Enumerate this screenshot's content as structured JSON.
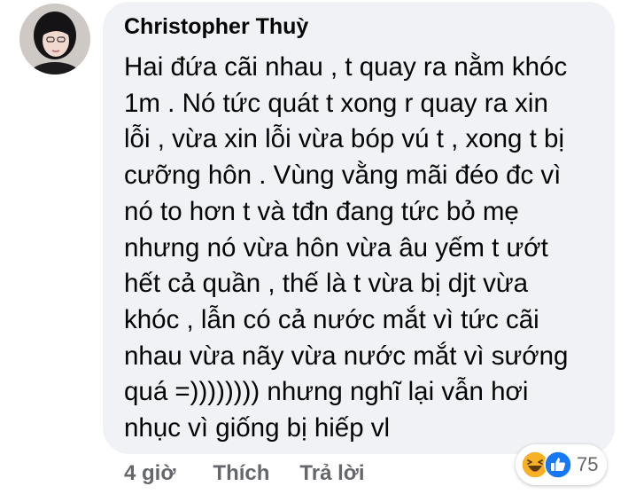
{
  "comment": {
    "author": "Christopher Thuỳ",
    "lines": [
      "Hai đứa cãi nhau , t quay ra nằm khóc",
      "1m . Nó tức quát t xong r quay ra xin",
      "lỗi , vừa xin lỗi vừa bóp vú t , xong t bị",
      "cưỡng hôn . Vùng vằng mãi đéo đc vì",
      "nó to hơn t và tđn đang tức bỏ mẹ",
      "nhưng nó vừa hôn vừa âu yếm t ướt",
      "hết cả quần , thế là t vừa bị djt vừa",
      "khóc , lẫn có cả nước mắt vì tức cãi",
      "nhau vừa nãy vừa nước mắt vì sướng",
      "quá =)))))))) nhưng nghĩ lại vẫn hơi",
      "nhục vì giống bị hiếp vl"
    ]
  },
  "actions": {
    "time": "4 giờ",
    "like": "Thích",
    "reply": "Trả lời"
  },
  "reactions": {
    "icons": [
      "haha-icon",
      "like-icon"
    ],
    "count": "75"
  },
  "colors": {
    "bubble": "#f0f2f5",
    "text": "#050505",
    "secondary": "#65676b",
    "like_blue": "#1877f2",
    "haha_yellow": "#f7b125"
  }
}
